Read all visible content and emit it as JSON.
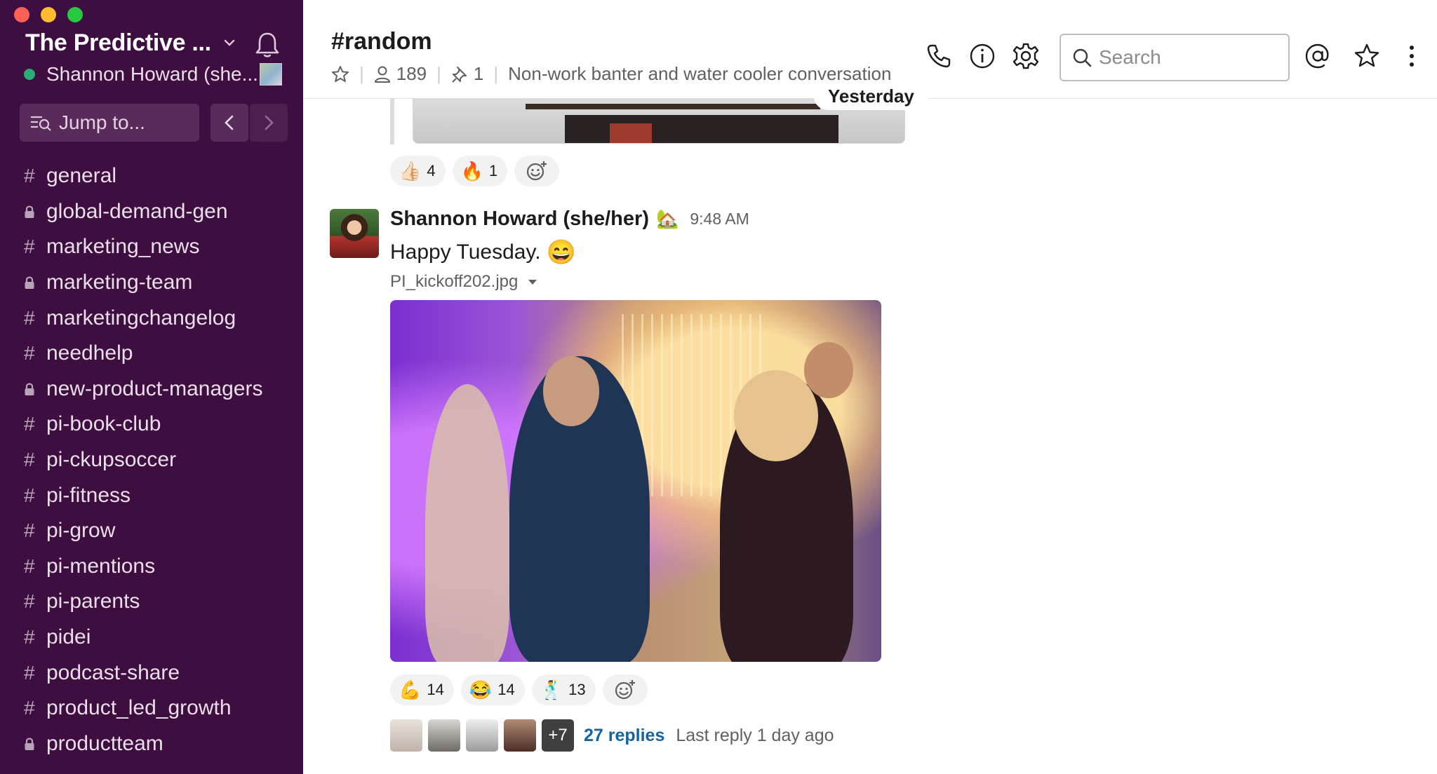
{
  "sidebar": {
    "workspace_name": "The Predictive ...",
    "user_name": "Shannon Howard (she...",
    "jump_label": "Jump to...",
    "channels": [
      {
        "name": "general",
        "prefix": "#"
      },
      {
        "name": "global-demand-gen",
        "prefix": "lock"
      },
      {
        "name": "marketing_news",
        "prefix": "#"
      },
      {
        "name": "marketing-team",
        "prefix": "lock"
      },
      {
        "name": "marketingchangelog",
        "prefix": "#"
      },
      {
        "name": "needhelp",
        "prefix": "#"
      },
      {
        "name": "new-product-managers",
        "prefix": "lock"
      },
      {
        "name": "pi-book-club",
        "prefix": "#"
      },
      {
        "name": "pi-ckupsoccer",
        "prefix": "#"
      },
      {
        "name": "pi-fitness",
        "prefix": "#"
      },
      {
        "name": "pi-grow",
        "prefix": "#"
      },
      {
        "name": "pi-mentions",
        "prefix": "#"
      },
      {
        "name": "pi-parents",
        "prefix": "#"
      },
      {
        "name": "pidei",
        "prefix": "#"
      },
      {
        "name": "podcast-share",
        "prefix": "#"
      },
      {
        "name": "product_led_growth",
        "prefix": "#"
      },
      {
        "name": "productteam",
        "prefix": "lock"
      }
    ]
  },
  "header": {
    "channel_title": "#random",
    "member_count": "189",
    "pinned_count": "1",
    "topic": "Non-work banter and water cooler conversation",
    "search_placeholder": "Search"
  },
  "messages": {
    "date_divider": "Yesterday",
    "prev_reactions": [
      {
        "emoji": "👍🏻",
        "count": "4"
      },
      {
        "emoji": "🔥",
        "count": "1"
      }
    ],
    "post": {
      "sender": "Shannon Howard (she/her)",
      "status_emoji": "🏡",
      "time": "9:48 AM",
      "text": "Happy Tuesday.",
      "text_emoji": "😄",
      "file_name": "PI_kickoff202.jpg",
      "reactions": [
        {
          "emoji": "💪",
          "count": "14"
        },
        {
          "emoji": "😂",
          "count": "14"
        },
        {
          "emoji": "🕺",
          "count": "13"
        }
      ],
      "thread_more": "+7",
      "replies": "27 replies",
      "last_reply": "Last reply 1 day ago"
    }
  },
  "colors": {
    "sidebar_bg": "#3f0e40",
    "link_blue": "#1264a3",
    "online_green": "#2bac76"
  }
}
